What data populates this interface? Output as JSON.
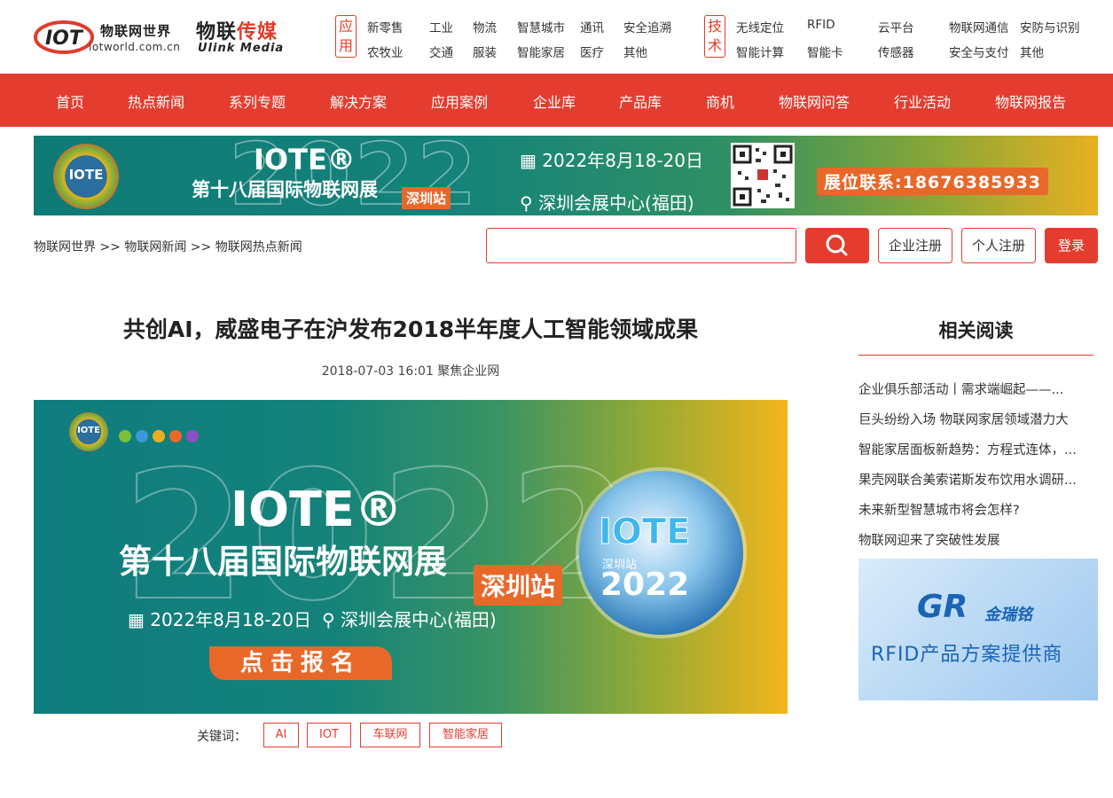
{
  "header": {
    "logo_cn": "物联网世界",
    "logo_url": "iotworld.com.cn",
    "ulink_cn_a": "物联",
    "ulink_cn_b": "传媒",
    "ulink_en": "Ulink Media",
    "app_label": "应用",
    "app_items": [
      "新零售",
      "工业",
      "物流",
      "智慧城市",
      "通讯",
      "安全追溯",
      "农牧业",
      "交通",
      "服装",
      "智能家居",
      "医疗",
      "其他"
    ],
    "tech_label": "技术",
    "tech_items": [
      "无线定位",
      "RFID",
      "云平台",
      "物联网通信",
      "安防与识别",
      "智能计算",
      "智能卡",
      "传感器",
      "安全与支付",
      "其他"
    ]
  },
  "nav": {
    "items": [
      "首页",
      "热点新闻",
      "系列专题",
      "解决方案",
      "应用案例",
      "企业库",
      "产品库",
      "商机",
      "物联网问答",
      "行业活动",
      "物联网报告"
    ]
  },
  "top_banner": {
    "badge": "IOTE",
    "big_year": "2022",
    "iote": "IOTE®",
    "expo": "第十八届国际物联网展",
    "city": "深圳站",
    "date": "2022年8月18-20日",
    "location": "深圳会展中心(福田)",
    "contact": "展位联系:18676385933"
  },
  "breadcrumb": {
    "text": "物联网世界 >> 物联网新闻 >> 物联网热点新闻"
  },
  "search": {
    "placeholder": ""
  },
  "auth": {
    "company_register": "企业注册",
    "personal_register": "个人注册",
    "login": "登录"
  },
  "article": {
    "title": "共创AI，威盛电子在沪发布2018半年度人工智能领域成果",
    "meta": "2018-07-03 16:01 聚焦企业网",
    "banner": {
      "badge": "IOTE",
      "big_year": "2022",
      "iote": "IOTE®",
      "expo": "第十八届国际物联网展",
      "city": "深圳站",
      "date": "2022年8月18-20日",
      "location": "深圳会展中心(福田)",
      "cta": "点击报名",
      "globe_title": "IOTE",
      "globe_city": "深圳站",
      "globe_year": "2022"
    },
    "keywords_label": "关键词：",
    "keywords": [
      "AI",
      "IOT",
      "车联网",
      "智能家居"
    ]
  },
  "sidebar": {
    "title": "相关阅读",
    "items": [
      "企业俱乐部活动丨需求端崛起——...",
      "巨头纷纷入场 物联网家居领域潜力大",
      "智能家居面板新趋势：方程式连体，...",
      "果壳网联合美索诺斯发布饮用水调研...",
      "未来新型智慧城市将会怎样?",
      "物联网迎来了突破性发展"
    ],
    "ad": {
      "brand_en": "GR",
      "brand_cn": "金瑞铭",
      "slogan": "RFID产品方案提供商"
    }
  },
  "colors": {
    "brand_red": "#e43d2f",
    "accent_orange": "#e8682a",
    "banner_teal": "#0f7c7e"
  }
}
